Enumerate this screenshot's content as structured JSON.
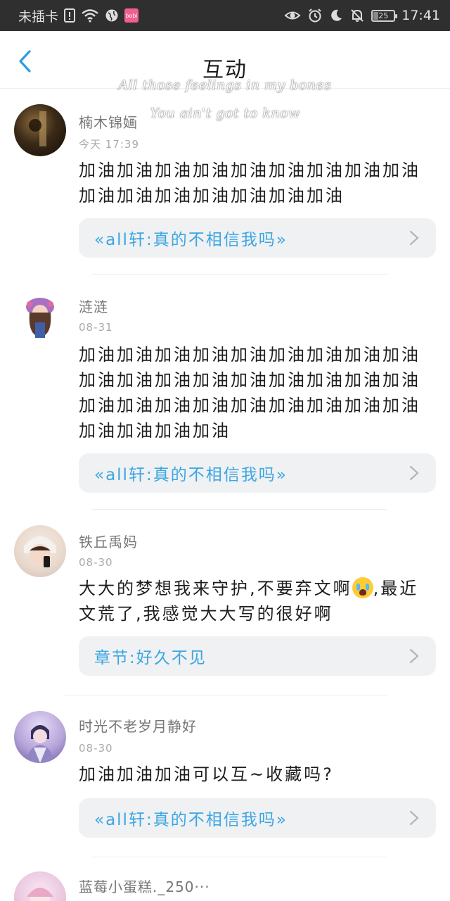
{
  "status_bar": {
    "carrier": "未插卡",
    "battery_level": "25",
    "battery_fraction": 0.25,
    "time": "17:41",
    "app_badge": "bobi"
  },
  "header": {
    "title": "互动",
    "back_icon": "chevron-left-icon"
  },
  "lyrics": [
    "All those feelings in my bones",
    "You ain't got to know"
  ],
  "comments": [
    {
      "username": "楠木锦婳",
      "date": "今天 17:39",
      "body": "加油加油加油加油加油加油加油加油加油加油加油加油加油加油加油加油",
      "ref": "«all轩:真的不相信我吗»"
    },
    {
      "username": "涟涟",
      "date": "08-31",
      "body": "加油加油加油加油加油加油加油加油加油加油加油加油加油加油加油加油加油加油加油加油加油加油加油加油加油加油加油加油加油加油加油",
      "ref": "«all轩:真的不相信我吗»"
    },
    {
      "username": "铁丘禹妈",
      "date": "08-30",
      "body_before_emoji": "大大的梦想我来守护,不要弃文啊",
      "body_after_emoji": ",最近文荒了,我感觉大大写的很好啊",
      "emoji": "crying-face",
      "ref": "章节:好久不见"
    },
    {
      "username": "时光不老岁月静好",
      "date": "08-30",
      "body": "加油加油加油可以互~收藏吗?",
      "ref": "«all轩:真的不相信我吗»"
    },
    {
      "username": "蓝莓小蛋糕._250···",
      "date": "",
      "body": "",
      "ref": ""
    }
  ],
  "colors": {
    "accent": "#3ba6e2",
    "status_bar_bg": "#2f2f2f",
    "card_bg": "#f0f1f3"
  }
}
